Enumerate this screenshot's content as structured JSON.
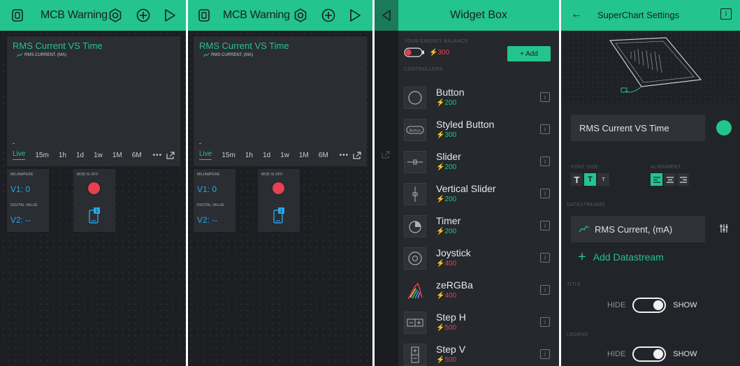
{
  "dashboard": {
    "title": "MCB Warning",
    "chart_title": "RMS Current VS Time",
    "legend_label": "RMS CURRENT, (MA)",
    "time_ranges": [
      "Live",
      "15m",
      "1h",
      "1d",
      "1w",
      "1M",
      "6M"
    ],
    "more_label": "•••",
    "widgets": {
      "milliampere_label": "MILIAMPERE",
      "milliampere_value": "V1: 0",
      "mcb_label": "MCB IS OFF",
      "digital_label": "DIGITAL VALUE",
      "digital_value": "V2: --"
    },
    "colors": {
      "accent": "#23c48e",
      "value": "#29a6e6",
      "led": "#e8404f"
    }
  },
  "widget_box": {
    "title": "Widget Box",
    "energy_label": "YOUR ENERGY BALANCE",
    "energy_amount": "300",
    "add_label": "+ Add",
    "controllers_label": "CONTROLLERS",
    "items": [
      {
        "name": "Button",
        "price": "200",
        "icon": "circle-icon"
      },
      {
        "name": "Styled Button",
        "price": "300",
        "icon": "styled-button-icon",
        "icon_text": "Button"
      },
      {
        "name": "Slider",
        "price": "200",
        "icon": "slider-icon"
      },
      {
        "name": "Vertical Slider",
        "price": "200",
        "icon": "vertical-slider-icon"
      },
      {
        "name": "Timer",
        "price": "200",
        "icon": "timer-icon"
      },
      {
        "name": "Joystick",
        "price": "400",
        "icon": "joystick-icon"
      },
      {
        "name": "zeRGBa",
        "price": "400",
        "icon": "zebra-icon"
      },
      {
        "name": "Step H",
        "price": "500",
        "icon": "step-h-icon"
      },
      {
        "name": "Step V",
        "price": "500",
        "icon": "step-v-icon"
      }
    ]
  },
  "settings": {
    "title": "SuperChart Settings",
    "back": "←",
    "info": "i",
    "chart_name": "RMS Current VS Time",
    "font_size_label": "FONT SIZE",
    "alignment_label": "ALIGNMENT",
    "font_sizes": [
      "T",
      "T",
      "T"
    ],
    "datastreams_label": "DATASTREAMS",
    "datastream_name": "RMS Current, (mA)",
    "add_datastream_label": "Add Datastream",
    "title_label": "TITLE",
    "legend_label": "LEGEND",
    "hide_label": "HIDE",
    "show_label": "SHOW"
  }
}
